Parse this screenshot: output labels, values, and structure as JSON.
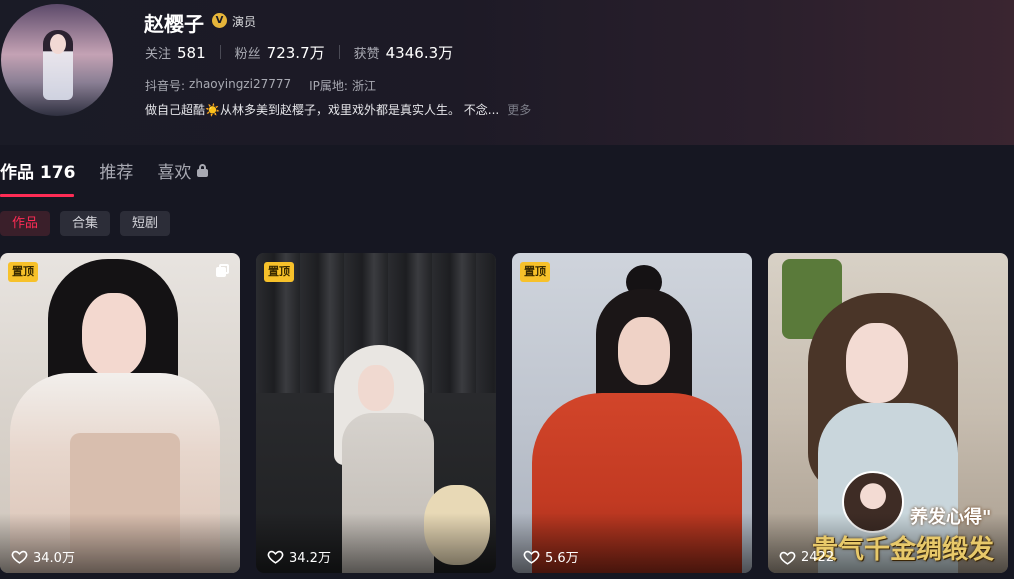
{
  "profile": {
    "name": "赵樱子",
    "verified_badge": "V",
    "role": "演员",
    "stats": [
      {
        "label": "关注",
        "value": "581"
      },
      {
        "label": "粉丝",
        "value": "723.7万"
      },
      {
        "label": "获赞",
        "value": "4346.3万"
      }
    ],
    "douyin_id_label": "抖音号:",
    "douyin_id": "zhaoyingzi27777",
    "ip_label": "IP属地:",
    "ip_location": "浙江",
    "bio": "做自己超酷☀️从林多美到赵樱子，戏里戏外都是真实人生。 不念...",
    "bio_more": "更多"
  },
  "tabs": [
    {
      "label": "作品 176"
    },
    {
      "label": "推荐"
    },
    {
      "label": "喜欢"
    }
  ],
  "chips": [
    {
      "label": "作品"
    },
    {
      "label": "合集"
    },
    {
      "label": "短剧"
    }
  ],
  "videos": [
    {
      "pinned": "置顶",
      "likes": "34.0万",
      "multi": true
    },
    {
      "pinned": "置顶",
      "likes": "34.2万"
    },
    {
      "pinned": "置顶",
      "likes": "5.6万"
    },
    {
      "likes": "2422",
      "caption_top": "养发心得\"",
      "caption_main": "贵气千金绸缎发"
    }
  ],
  "colors": {
    "accent": "#fe2c55",
    "pin_badge": "#f7c12a",
    "verified": "#e6b53a"
  }
}
